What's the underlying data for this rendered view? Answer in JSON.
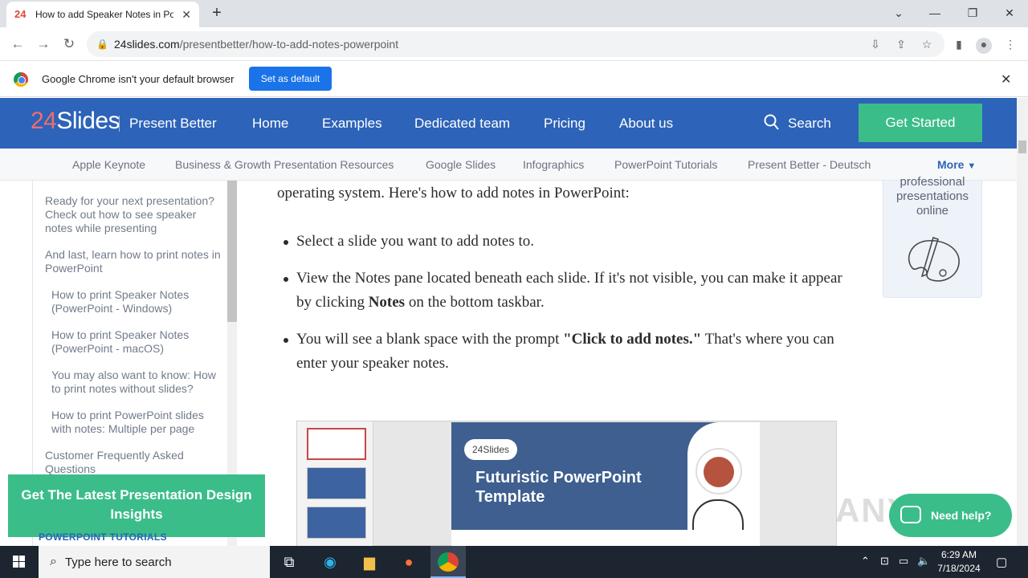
{
  "browser": {
    "tab_title": "How to add Speaker Notes in Po",
    "tab_favicon": "24",
    "url_domain": "24slides.com",
    "url_path": "/presentbetter/how-to-add-notes-powerpoint",
    "infobar_text": "Google Chrome isn't your default browser",
    "set_default_label": "Set as default"
  },
  "site": {
    "logo_num": "24",
    "logo_word": "Slides",
    "tagline": "Present Better",
    "nav": [
      "Home",
      "Examples",
      "Dedicated team",
      "Pricing",
      "About us"
    ],
    "search_label": "Search",
    "cta_label": "Get Started",
    "subnav": [
      "Apple Keynote",
      "Business & Growth Presentation Resources",
      "Google Slides",
      "Infographics",
      "PowerPoint Tutorials",
      "Present Better - Deutsch"
    ],
    "more_label": "More",
    "brand_blue": "#2d63b8",
    "brand_green": "#3bbd8a"
  },
  "toc": {
    "items": [
      "Ready for your next presentation? Check out how to see speaker notes while presenting",
      "And last, learn how to print notes in PowerPoint",
      "How to print Speaker Notes (PowerPoint - Windows)",
      "How to print Speaker Notes (PowerPoint - macOS)",
      "You may also want to know: How to print notes without slides?",
      "How to print PowerPoint slides with notes: Multiple per page",
      "Customer Frequently Asked Questions"
    ],
    "footer": "POWERPOINT TUTORIALS"
  },
  "article": {
    "intro": "operating system. Here's how to add notes in PowerPoint:",
    "bullet1": "Select a slide you want to add notes to.",
    "bullet2_a": "View the Notes pane located beneath each slide. If it's not visible, you can make it appear by clicking ",
    "bullet2_bold": "Notes",
    "bullet2_b": " on the bottom taskbar.",
    "bullet3_a": "You will see a blank space with the prompt ",
    "bullet3_bold": "\"Click to add notes.\"",
    "bullet3_b": " That's where you can enter your speaker notes."
  },
  "slide": {
    "logo": "24Slides",
    "title_line1": "Futuristic PowerPoint",
    "title_line2": "Template"
  },
  "promo": {
    "text": "professional presentations online"
  },
  "newsletter_cta": "Get The Latest Presentation Design Insights",
  "help_label": "Need help?",
  "watermark": "ANY RUN",
  "taskbar": {
    "search_placeholder": "Type here to search",
    "time": "6:29 AM",
    "date": "7/18/2024"
  }
}
